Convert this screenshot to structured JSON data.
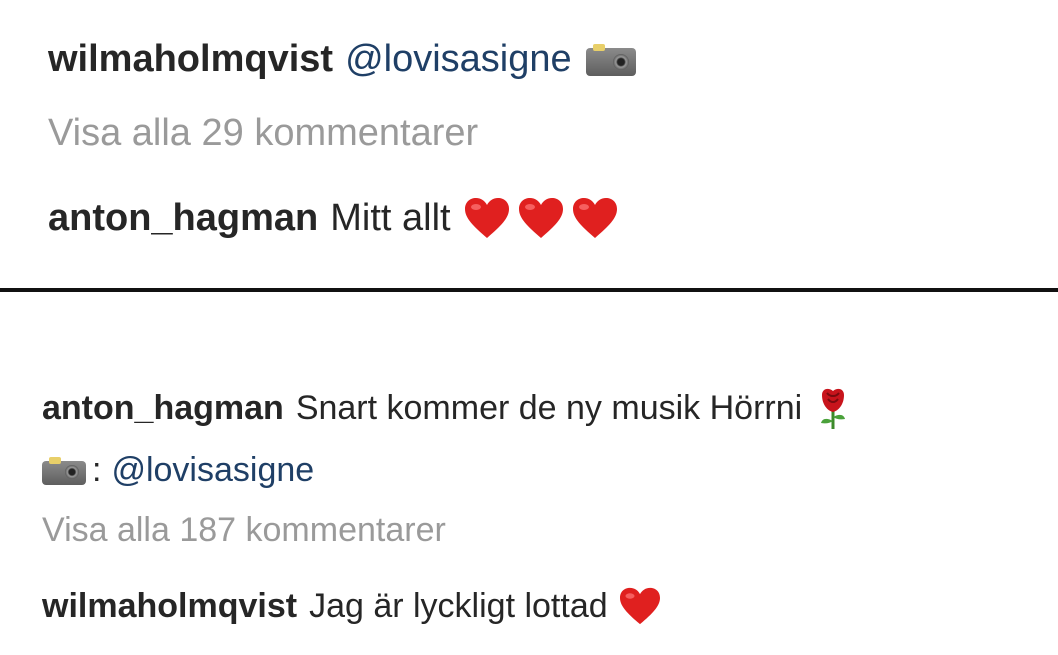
{
  "top_post": {
    "caption": {
      "username": "wilmaholmqvist",
      "mention": "@lovisasigne",
      "icon": "camera-icon"
    },
    "view_all": "Visa alla 29 kommentarer",
    "comment": {
      "username": "anton_hagman",
      "text": "Mitt allt",
      "emoji": [
        "heart-icon",
        "heart-icon",
        "heart-icon"
      ]
    }
  },
  "bottom_post": {
    "caption": {
      "username": "anton_hagman",
      "text": "Snart kommer de ny musik Hörrni",
      "emoji": "rose-icon"
    },
    "credit": {
      "icon": "camera-icon",
      "separator": ":",
      "mention": "@lovisasigne"
    },
    "view_all": "Visa alla 187 kommentarer",
    "comment": {
      "username": "wilmaholmqvist",
      "text": "Jag är lyckligt lottad",
      "emoji": "heart-icon"
    }
  },
  "colors": {
    "text": "#262626",
    "mention": "#1f3f66",
    "muted": "#9a9a9a",
    "divider": "#111111",
    "heart": "#e0201f"
  }
}
